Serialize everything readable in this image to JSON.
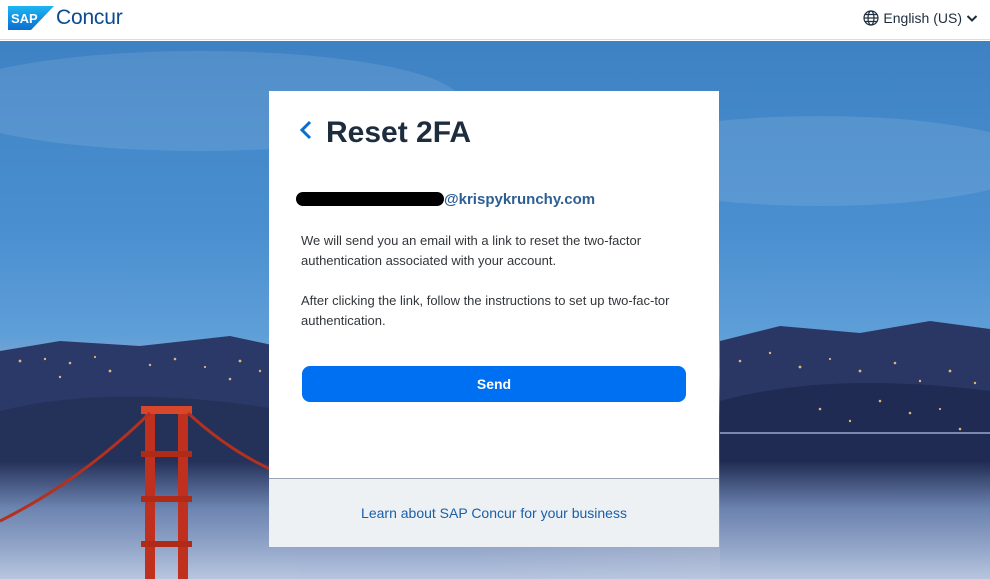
{
  "header": {
    "brand_sap": "SAP",
    "brand_product": "Concur",
    "language_label": "English (US)"
  },
  "card": {
    "title": "Reset 2FA",
    "email_domain": "@krispykrunchy.com",
    "paragraph1": "We will send you an email with a link to reset the two-factor authentication associated with your account.",
    "paragraph2": "After clicking the link, follow the instructions to set up two-fac-tor authentication.",
    "send_label": "Send",
    "footer_link": "Learn about SAP Concur for your business"
  },
  "colors": {
    "primary_button": "#0070f2",
    "title_text": "#1d2d3e",
    "link": "#1a5fa8",
    "brand_blue": "#0a4b8f"
  },
  "icons": {
    "back": "chevron-left-icon",
    "language": "globe-icon",
    "language_dropdown": "chevron-down-icon"
  }
}
